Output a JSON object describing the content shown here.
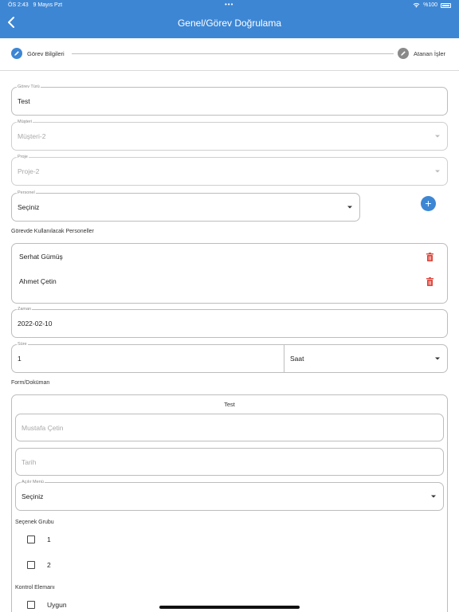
{
  "status_bar": {
    "time": "ÖS 2:43",
    "date": "9 Mayıs Pzt",
    "dots": "•••",
    "battery": "%100"
  },
  "header": {
    "title": "Genel/Görev Doğrulama",
    "back_icon": "chevron-left-icon"
  },
  "stepper": {
    "steps": [
      {
        "label": "Görev Bilgileri",
        "active": true,
        "icon": "pencil-icon"
      },
      {
        "label": "Atanan İşler",
        "active": false,
        "icon": "pencil-icon"
      }
    ]
  },
  "fields": {
    "gorev_turu": {
      "label": "Görev Türü",
      "value": "Test"
    },
    "musteri": {
      "label": "Müşteri",
      "value": "Müşteri-2",
      "disabled": true
    },
    "proje": {
      "label": "Proje",
      "value": "Proje-2",
      "disabled": true
    },
    "personel": {
      "label": "Personel",
      "value": "Seçiniz"
    },
    "zaman": {
      "label": "Zaman",
      "value": "2022-02-10"
    },
    "sure": {
      "label": "Süre",
      "value": "1"
    },
    "sure_birim": {
      "value": "Saat"
    }
  },
  "personnel_section": {
    "title": "Görevde Kullanılacak Personeller",
    "items": [
      {
        "name": "Serhat Gümüş"
      },
      {
        "name": "Ahmet Çetin"
      }
    ]
  },
  "form_section": {
    "title": "Form/Doküman",
    "form_name": "Test",
    "text_field_1": {
      "placeholder": "Mustafa Çetin"
    },
    "text_field_2": {
      "placeholder": "Tarih"
    },
    "dropdown": {
      "label": "Açılır Menü",
      "value": "Seçiniz"
    },
    "option_group": {
      "title": "Seçenek Grubu",
      "options": [
        "1",
        "2"
      ]
    },
    "control_group": {
      "title": "Kontrol Elemanı",
      "options": [
        "Uygun"
      ]
    }
  },
  "colors": {
    "primary": "#3d86d4",
    "danger": "#e0453a",
    "inactive": "#8a8a8a"
  }
}
